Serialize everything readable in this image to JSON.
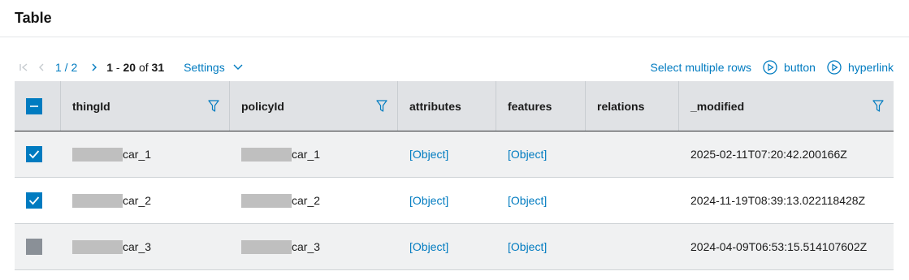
{
  "header": {
    "title": "Table"
  },
  "pagination": {
    "page": "1 / 2",
    "range_start": "1",
    "range_sep": " - ",
    "range_end": "20",
    "of_label": " of ",
    "total": "31",
    "settings_label": "Settings"
  },
  "actions": {
    "select_multiple": "Select multiple rows",
    "button": "button",
    "hyperlink": "hyperlink"
  },
  "columns": [
    "thingId",
    "policyId",
    "attributes",
    "features",
    "relations",
    "_modified"
  ],
  "rows": [
    {
      "selected": "checked",
      "thingId": "car_1",
      "policyId": "car_1",
      "attributes": "[Object]",
      "features": "[Object]",
      "relations": "",
      "modified": "2025-02-11T07:20:42.200166Z"
    },
    {
      "selected": "checked",
      "thingId": "car_2",
      "policyId": "car_2",
      "attributes": "[Object]",
      "features": "[Object]",
      "relations": "",
      "modified": "2024-11-19T08:39:13.022118428Z"
    },
    {
      "selected": "unchecked",
      "thingId": "car_3",
      "policyId": "car_3",
      "attributes": "[Object]",
      "features": "[Object]",
      "relations": "",
      "modified": "2024-04-09T06:53:15.514107602Z"
    }
  ],
  "colors": {
    "accent": "#007bc0",
    "header_bg": "#e0e2e5"
  }
}
